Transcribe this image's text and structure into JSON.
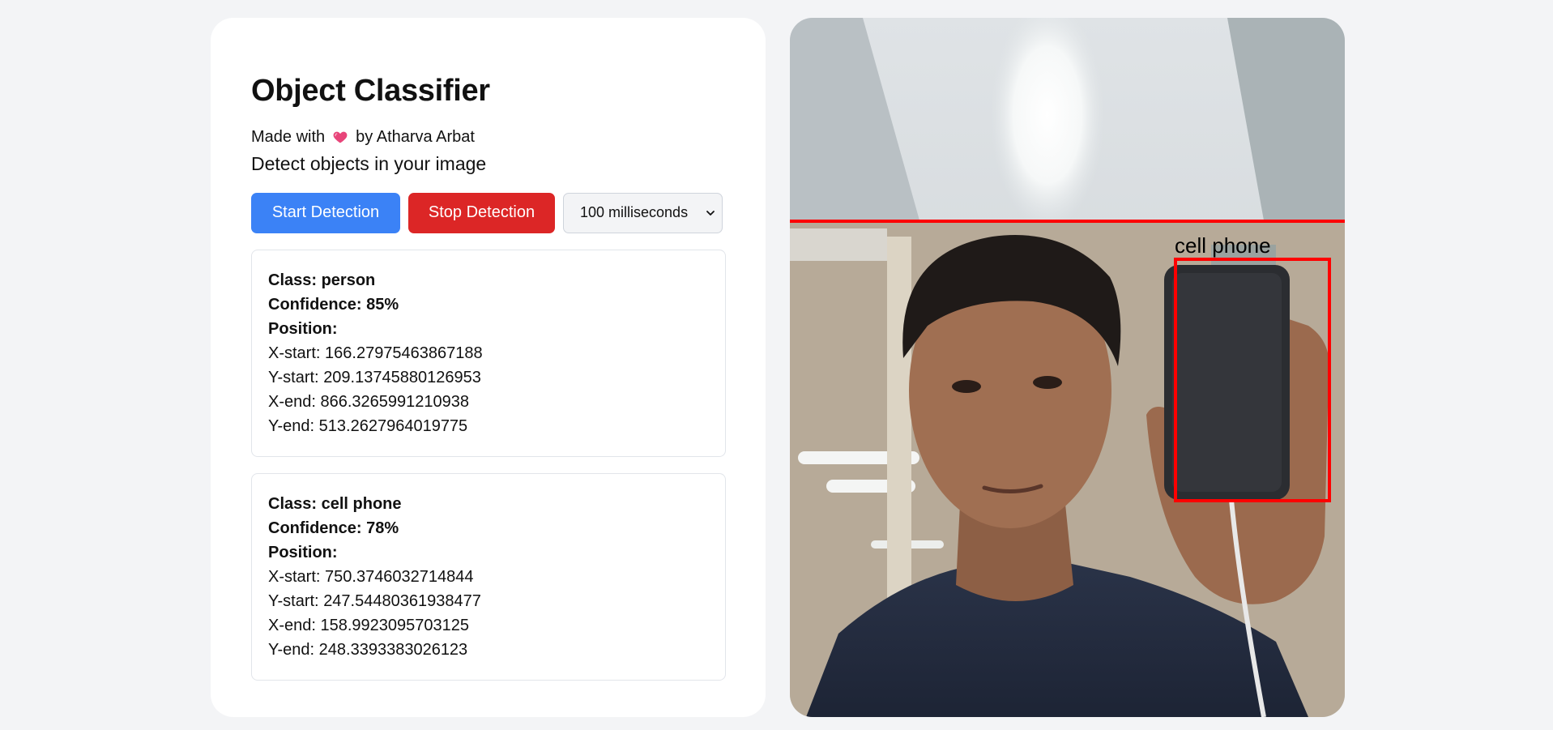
{
  "app": {
    "title": "Object Classifier",
    "credit_prefix": "Made with",
    "credit_suffix": "by Atharva Arbat",
    "subtitle": "Detect objects in your image"
  },
  "controls": {
    "start_label": "Start Detection",
    "stop_label": "Stop Detection",
    "interval_selected": "100 milliseconds"
  },
  "labels": {
    "class": "Class:",
    "confidence": "Confidence:",
    "position": "Position:",
    "x_start": "X-start:",
    "y_start": "Y-start:",
    "x_end": "X-end:",
    "y_end": "Y-end:"
  },
  "detections": [
    {
      "class": "person",
      "confidence": "85%",
      "x_start": "166.27975463867188",
      "y_start": "209.13745880126953",
      "x_end": "866.3265991210938",
      "y_end": "513.2627964019775"
    },
    {
      "class": "cell phone",
      "confidence": "78%",
      "x_start": "750.3746032714844",
      "y_start": "247.54480361938477",
      "x_end": "158.9923095703125",
      "y_end": "248.3393383026123"
    }
  ],
  "camera": {
    "box_label": "cell phone",
    "box_color": "#ff0000"
  },
  "colors": {
    "start_button": "#3b82f6",
    "stop_button": "#dc2626",
    "heart": "#e8457a",
    "page_bg": "#f3f4f6"
  },
  "icons": {
    "heart": "heart-icon",
    "dropdown": "chevron-down-icon"
  }
}
